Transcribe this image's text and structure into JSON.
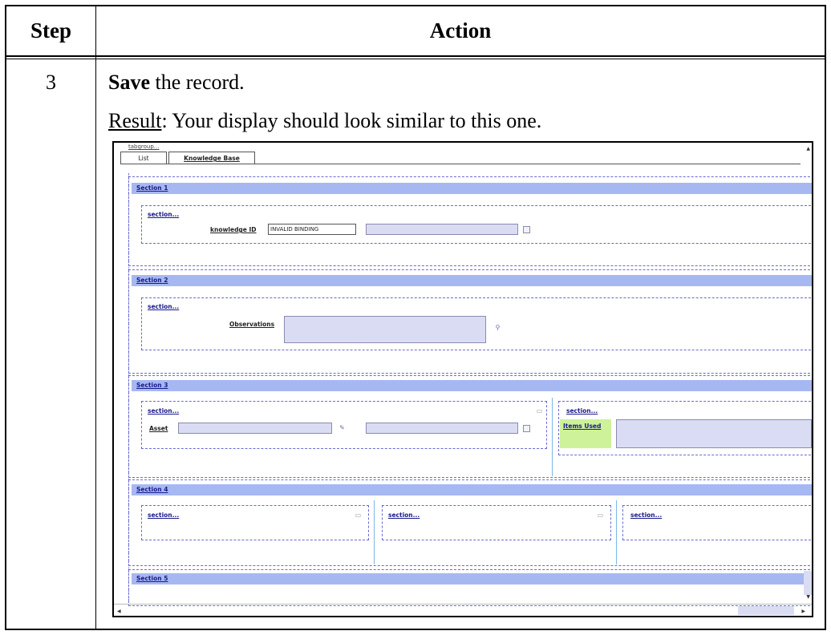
{
  "table": {
    "col_step": "Step",
    "col_action": "Action",
    "step_number": "3",
    "action_bold": "Save",
    "action_rest": " the record.",
    "result_label": "Result",
    "result_text": ": Your display should look similar to this one."
  },
  "screenshot": {
    "tabgroup_label": "tabgroup...",
    "tabs": [
      "List",
      "Knowledge Base"
    ],
    "sections": [
      {
        "title": "Section 1"
      },
      {
        "title": "Section 2"
      },
      {
        "title": "Section 3"
      },
      {
        "title": "Section 4"
      },
      {
        "title": "Section 5"
      }
    ],
    "sub_section_label": "section...",
    "section1": {
      "field_label": "knowledge ID",
      "field_value": "INVALID BINDING"
    },
    "section2": {
      "field_label": "Observations"
    },
    "section3": {
      "field_label": "Asset",
      "items_label": "Items Used"
    },
    "colors": {
      "section_bar": "#a6b8f2",
      "field_fill": "#dadcf4",
      "items_label_fill": "#cdf29a"
    }
  }
}
